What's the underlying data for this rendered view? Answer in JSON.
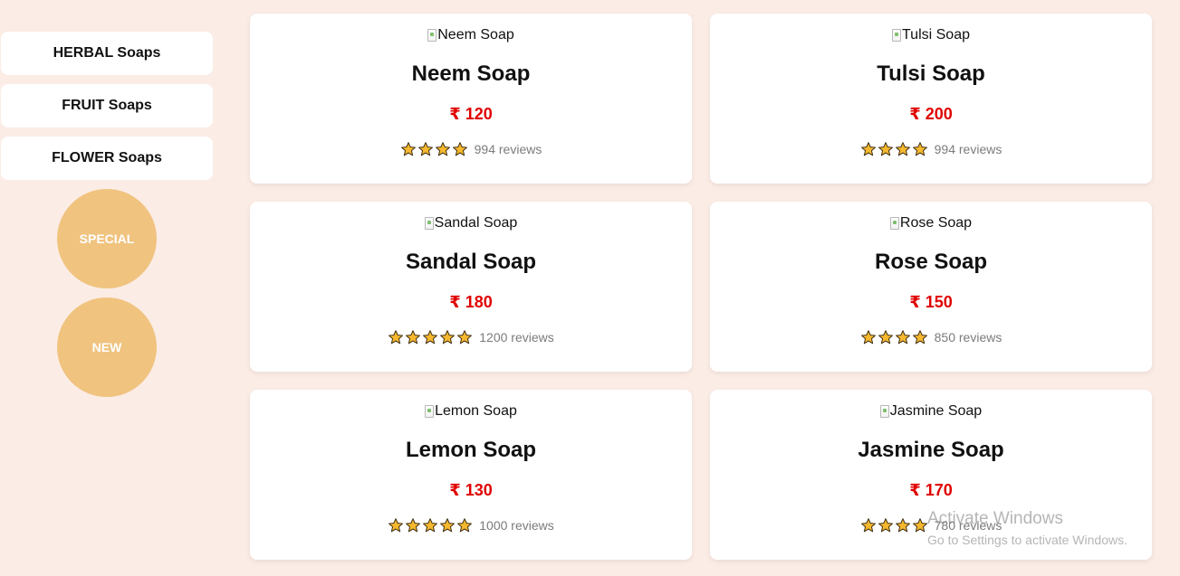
{
  "sidebar": {
    "categories": [
      {
        "label": "HERBAL Soaps"
      },
      {
        "label": "FRUIT Soaps"
      },
      {
        "label": "FLOWER Soaps"
      }
    ],
    "special_label": "SPECIAL",
    "new_label": "NEW"
  },
  "currency_symbol": "₹",
  "products": [
    {
      "img_alt": "Neem Soap",
      "name": "Neem Soap",
      "price": "₹ 120",
      "stars": 4,
      "reviews": "994 reviews"
    },
    {
      "img_alt": "Tulsi Soap",
      "name": "Tulsi Soap",
      "price": "₹ 200",
      "stars": 4,
      "reviews": "994 reviews"
    },
    {
      "img_alt": "Sandal Soap",
      "name": "Sandal Soap",
      "price": "₹ 180",
      "stars": 5,
      "reviews": "1200 reviews"
    },
    {
      "img_alt": "Rose Soap",
      "name": "Rose Soap",
      "price": "₹ 150",
      "stars": 4,
      "reviews": "850 reviews"
    },
    {
      "img_alt": "Lemon Soap",
      "name": "Lemon Soap",
      "price": "₹ 130",
      "stars": 5,
      "reviews": "1000 reviews"
    },
    {
      "img_alt": "Jasmine Soap",
      "name": "Jasmine Soap",
      "price": "₹ 170",
      "stars": 4,
      "reviews": "780 reviews"
    }
  ],
  "colors": {
    "background": "#fbece5",
    "card": "#ffffff",
    "price": "#e00000",
    "circle": "#f0c37f",
    "star_fill": "#f5b82e"
  },
  "watermark": {
    "title": "Activate Windows",
    "subtitle": "Go to Settings to activate Windows."
  }
}
